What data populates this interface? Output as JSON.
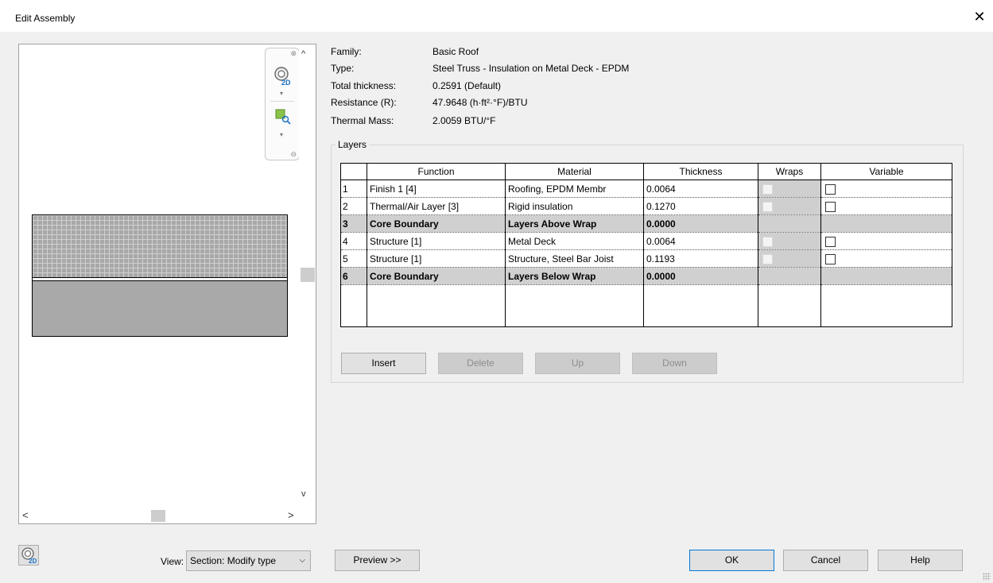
{
  "window": {
    "title": "Edit Assembly",
    "close_glyph": "✕"
  },
  "info": {
    "family_label": "Family:",
    "family_value": "Basic Roof",
    "type_label": "Type:",
    "type_value": "Steel Truss - Insulation on Metal Deck - EPDM",
    "thickness_label": "Total thickness:",
    "thickness_value": "0.2591 (Default)",
    "resistance_label": "Resistance (R):",
    "resistance_value": "47.9648 (h·ft²·°F)/BTU",
    "mass_label": "Thermal Mass:",
    "mass_value": "2.0059 BTU/°F"
  },
  "layers": {
    "caption": "Layers",
    "columns": {
      "num": "",
      "function": "Function",
      "material": "Material",
      "thickness": "Thickness",
      "wraps": "Wraps",
      "variable": "Variable"
    },
    "rows": [
      {
        "num": "1",
        "function": "Finish 1 [4]",
        "material": "Roofing, EPDM Membr",
        "thickness": "0.0064"
      },
      {
        "num": "2",
        "function": "Thermal/Air Layer [3]",
        "material": "Rigid insulation",
        "thickness": "0.1270"
      },
      {
        "num": "3",
        "function": "Core Boundary",
        "material": "Layers Above Wrap",
        "thickness": "0.0000"
      },
      {
        "num": "4",
        "function": "Structure [1]",
        "material": "Metal Deck",
        "thickness": "0.0064"
      },
      {
        "num": "5",
        "function": "Structure [1]",
        "material": "Structure, Steel Bar Joist",
        "thickness": "0.1193"
      },
      {
        "num": "6",
        "function": "Core Boundary",
        "material": "Layers Below Wrap",
        "thickness": "0.0000"
      }
    ]
  },
  "layer_buttons": {
    "insert": "Insert",
    "delete": "Delete",
    "up": "Up",
    "down": "Down"
  },
  "footer": {
    "view_label": "View:",
    "view_value": "Section: Modify type",
    "preview": "Preview >>",
    "ok": "OK",
    "cancel": "Cancel",
    "help": "Help"
  },
  "icons": {
    "wheel": "steering-wheel-2d-icon",
    "zoom": "zoom-region-icon",
    "scroll_up": "^",
    "scroll_down": "v",
    "scroll_left": "<",
    "scroll_right": ">"
  }
}
